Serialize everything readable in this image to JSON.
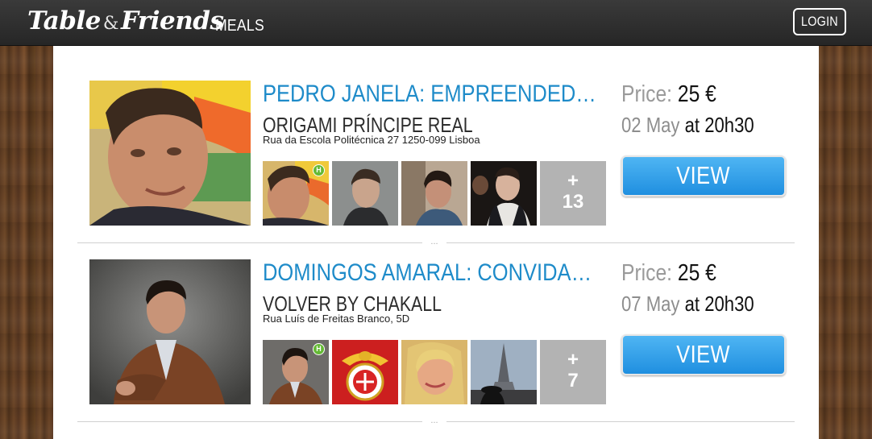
{
  "nav": {
    "logo_part1": "Table",
    "logo_amp": "&",
    "logo_part2": "Friends",
    "meals_label": "MEALS",
    "login_label": "LOGIN"
  },
  "meals": [
    {
      "title": "PEDRO JANELA: EMPREENDEDOR CON…",
      "venue": "ORIGAMI PRÍNCIPE REAL",
      "address": "Rua da Escola Politécnica 27 1250-099 Lisboa",
      "price_label": "Price:",
      "price_value": "25 €",
      "date_day": "02 May",
      "date_time": "at 20h30",
      "host_badge": "H",
      "more_plus": "+",
      "more_count": "13",
      "view_label": "VIEW"
    },
    {
      "title": "DOMINGOS AMARAL: CONVIDADO ES…",
      "venue": "VOLVER BY CHAKALL",
      "address": "Rua Luís de Freitas Branco, 5D",
      "price_label": "Price:",
      "price_value": "25 €",
      "date_day": "07 May",
      "date_time": "at 20h30",
      "host_badge": "H",
      "more_plus": "+",
      "more_count": "7",
      "view_label": "VIEW"
    }
  ],
  "separator_dots": "...",
  "colors": {
    "title_blue": "#1e8bc9",
    "button_blue": "#2a9be8",
    "host_badge_green": "#64b934",
    "more_gray": "#b3b3b3"
  }
}
